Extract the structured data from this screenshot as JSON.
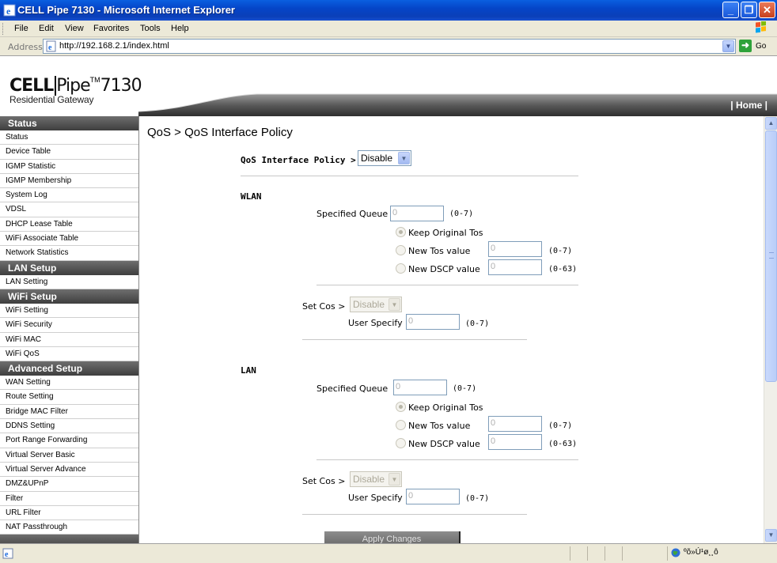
{
  "window": {
    "title": "CELL Pipe 7130 - Microsoft Internet Explorer",
    "minimize": "_",
    "maximize": "❐",
    "close": "✕"
  },
  "menubar": {
    "items": [
      {
        "label": "File"
      },
      {
        "label": "Edit"
      },
      {
        "label": "View"
      },
      {
        "label": "Favorites"
      },
      {
        "label": "Tools"
      },
      {
        "label": "Help"
      }
    ]
  },
  "addressbar": {
    "label": "Address",
    "url": "http://192.168.2.1/index.html",
    "go_label": "Go"
  },
  "header": {
    "logo_box": "CELL",
    "logo_rest": "Pipe",
    "logo_tm": "TM",
    "logo_model": "7130",
    "tagline": "Residential Gateway",
    "home_link": "| Home |"
  },
  "sidebar": {
    "sections": [
      {
        "title": "Status",
        "items": [
          "Status",
          "Device Table",
          "IGMP Statistic",
          "IGMP Membership",
          "System Log",
          "VDSL",
          "DHCP Lease Table",
          "WiFi Associate Table",
          "Network Statistics"
        ]
      },
      {
        "title": "LAN Setup",
        "items": [
          "LAN Setting"
        ]
      },
      {
        "title": "WiFi Setup",
        "items": [
          "WiFi Setting",
          "WiFi Security",
          "WiFi MAC",
          "WiFi QoS"
        ]
      },
      {
        "title": "Advanced Setup",
        "items": [
          "WAN Setting",
          "Route Setting",
          "Bridge MAC Filter",
          "DDNS Setting",
          "Port Range Forwarding",
          "Virtual Server Basic",
          "Virtual Server Advance",
          "DMZ&UPnP",
          "Filter",
          "URL Filter",
          "NAT Passthrough"
        ]
      }
    ]
  },
  "main": {
    "breadcrumb": "QoS > QoS Interface Policy",
    "policy_label": "QoS Interface Policy >",
    "policy_value": "Disable",
    "wlan": {
      "heading": "WLAN",
      "specified_queue_label": "Specified Queue",
      "specified_queue_value": "0",
      "specified_queue_range": "(0-7)",
      "keep_tos_label": "Keep Original Tos",
      "new_tos_label": "New Tos value",
      "new_tos_value": "0",
      "new_tos_range": "(0-7)",
      "new_dscp_label": "New DSCP value",
      "new_dscp_value": "0",
      "new_dscp_range": "(0-63)",
      "set_cos_label": "Set Cos >",
      "set_cos_value": "Disable",
      "user_specify_label": "User Specify",
      "user_specify_value": "0",
      "user_specify_range": "(0-7)"
    },
    "lan": {
      "heading": "LAN",
      "specified_queue_label": "Specified Queue",
      "specified_queue_value": "0",
      "specified_queue_range": "(0-7)",
      "keep_tos_label": "Keep Original Tos",
      "new_tos_label": "New Tos value",
      "new_tos_value": "0",
      "new_tos_range": "(0-7)",
      "new_dscp_label": "New DSCP value",
      "new_dscp_value": "0",
      "new_dscp_range": "(0-63)",
      "set_cos_label": "Set Cos >",
      "set_cos_value": "Disable",
      "user_specify_label": "User Specify",
      "user_specify_value": "0",
      "user_specify_range": "(0-7)"
    },
    "apply_label": "Apply Changes"
  },
  "statusbar": {
    "zone_text": "ºõ»Ú¹ø¸¸ô"
  },
  "colors": {
    "titlebar": "#0a4fd4",
    "sidebar_header": "#4a4a4a",
    "chrome": "#ece9d8"
  }
}
